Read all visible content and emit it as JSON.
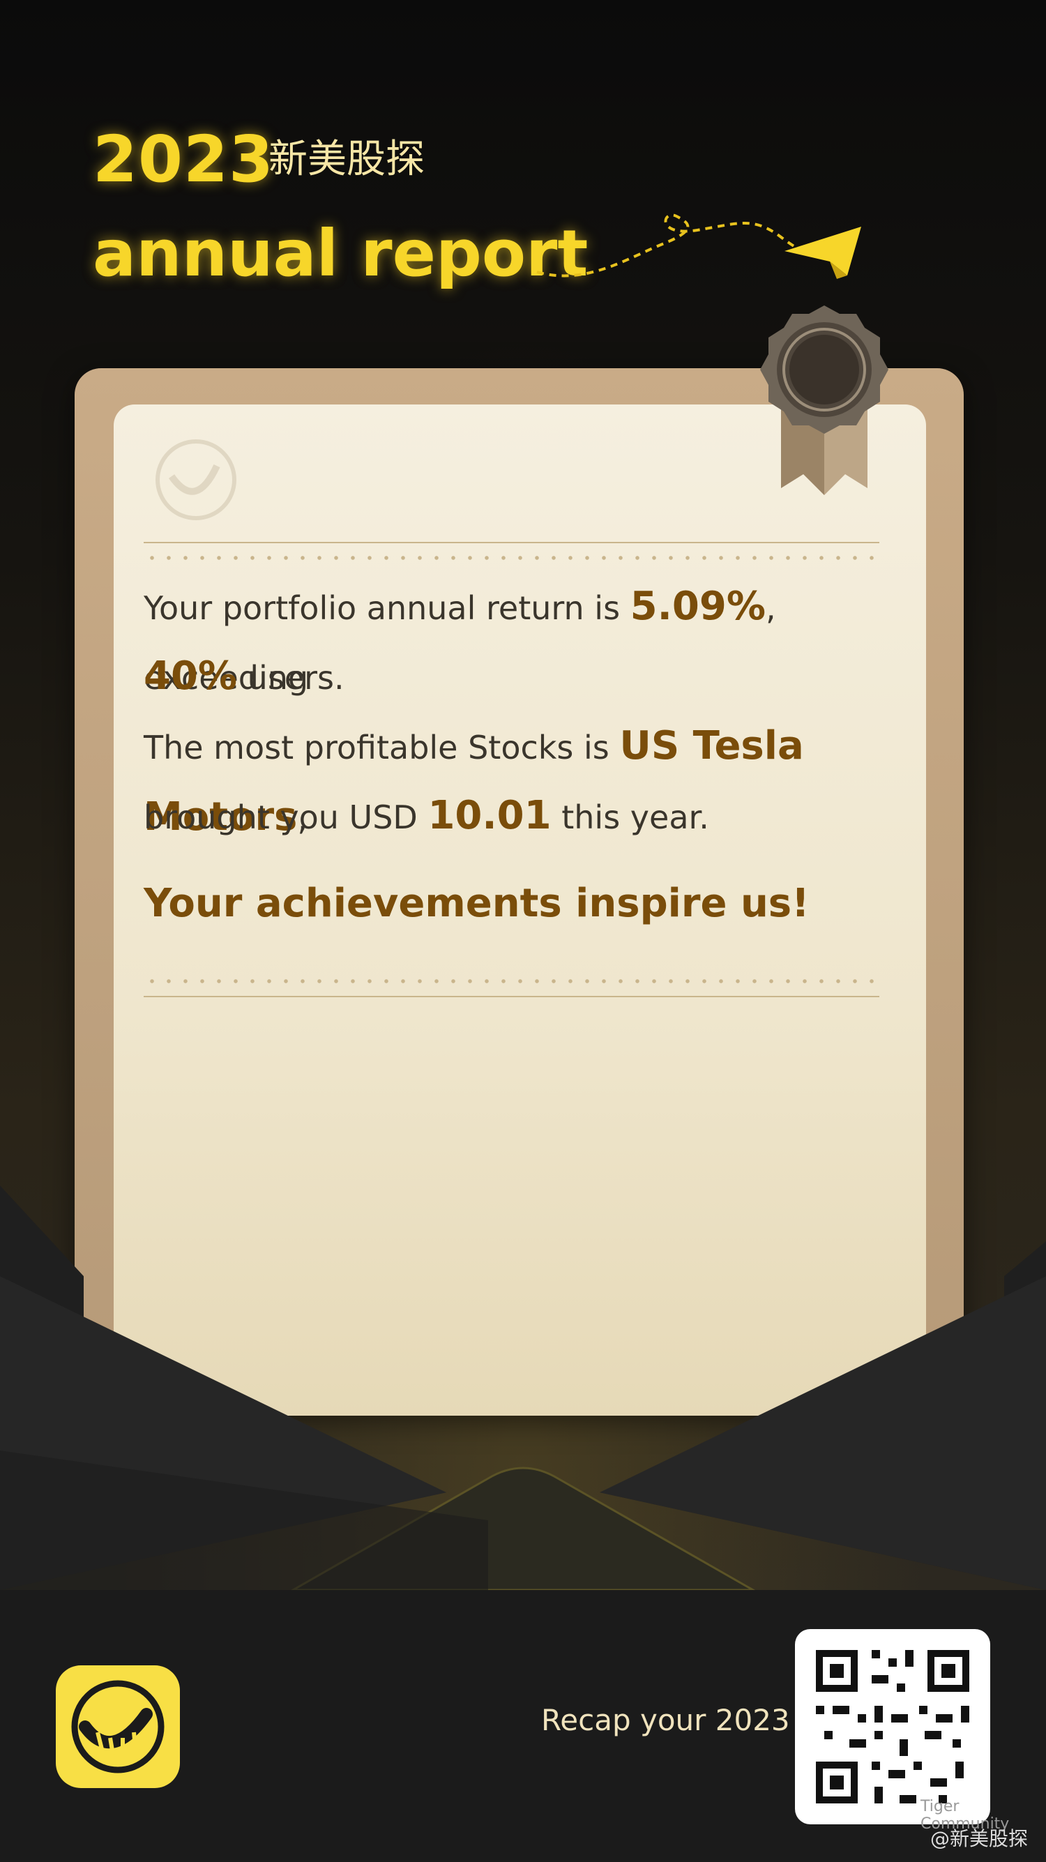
{
  "header": {
    "year": "2023",
    "brand": "新美股探",
    "title": "annual report"
  },
  "report": {
    "line1_prefix": "Your portfolio annual return is ",
    "annual_return": "5.09%",
    "line1_mid": ", exceeding",
    "exceed_percent": "40%",
    "line1_suffix": " users.",
    "line2_prefix": "The most profitable Stocks is ",
    "top_stock": "US Tesla Motors",
    "line2_comma": ",",
    "line3_prefix": "brought you USD ",
    "profit": "10.01",
    "line3_suffix": " this year.",
    "inspire": "Your achievements inspire us!"
  },
  "footer": {
    "recap": "Recap your 2023",
    "qr_caption": "Tiger Community",
    "handle": "@新美股探"
  },
  "icons": {
    "app_logo": "tiger-logo-icon",
    "seal": "award-seal-icon",
    "plane": "paper-plane-icon"
  },
  "colors": {
    "accent_yellow": "#f7d62a",
    "highlight_brown": "#7a4d0a",
    "card_paper": "#f5efdf"
  }
}
